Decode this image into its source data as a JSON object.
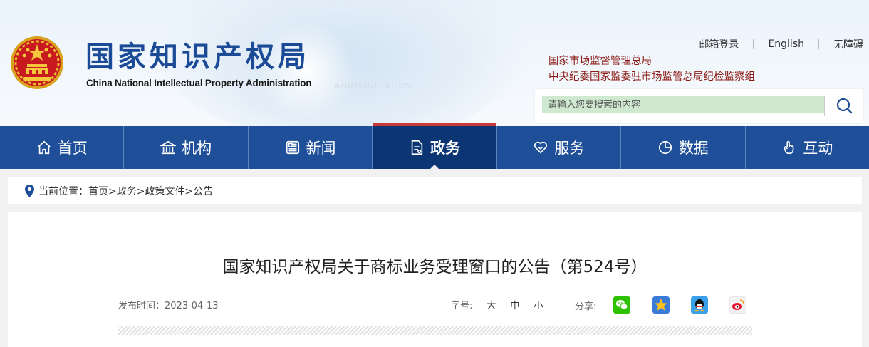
{
  "header": {
    "site_name_cn": "国家知识产权局",
    "site_name_en": "China National Intellectual Property Administration",
    "top_links": [
      "邮箱登录",
      "English",
      "无障碍"
    ],
    "org_links": [
      "国家市场监督管理总局",
      "中央纪委国家监委驻市场监管总局纪检监察组"
    ],
    "search_placeholder": "请输入您要搜索的内容",
    "icons": {
      "emblem": "national-emblem",
      "search": "search-icon"
    }
  },
  "nav": {
    "items": [
      {
        "label": "首页",
        "icon": "home-icon"
      },
      {
        "label": "机构",
        "icon": "institution-icon"
      },
      {
        "label": "新闻",
        "icon": "newspaper-icon"
      },
      {
        "label": "政务",
        "icon": "document-icon",
        "active": true
      },
      {
        "label": "服务",
        "icon": "heart-hand-icon"
      },
      {
        "label": "数据",
        "icon": "pie-chart-icon"
      },
      {
        "label": "互动",
        "icon": "hand-pointer-icon"
      }
    ]
  },
  "breadcrumb": {
    "prefix": "当前位置：",
    "items": [
      "首页",
      "政务",
      "政策文件",
      "公告"
    ],
    "separator": ">"
  },
  "article": {
    "title": "国家知识产权局关于商标业务受理窗口的公告（第524号）",
    "date_label": "发布时间：",
    "date": "2023-04-13",
    "font_size_label": "字号:",
    "font_sizes": [
      "大",
      "中",
      "小"
    ],
    "share_label": "分享:",
    "share_icons": [
      "wechat-icon",
      "qzone-icon",
      "qq-icon",
      "weibo-icon"
    ]
  },
  "colors": {
    "nav_bg": "#1e4f98",
    "nav_active": "#0b3673",
    "nav_active_top": "#c93a3a",
    "brand_blue": "#1b4b97",
    "org_red": "#8b1a14",
    "search_field": "#cfe8d0"
  }
}
